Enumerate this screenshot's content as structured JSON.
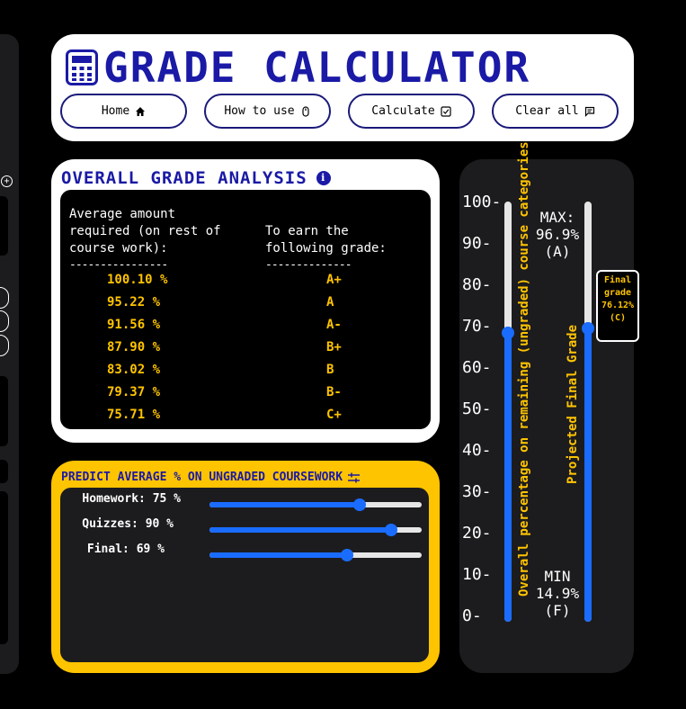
{
  "header": {
    "title": "GRADE CALCULATOR",
    "nav": [
      {
        "label": "Home",
        "icon": "home-icon"
      },
      {
        "label": "How to use",
        "icon": "mouse-icon"
      },
      {
        "label": "Calculate",
        "icon": "checkbox-icon"
      },
      {
        "label": "Clear all",
        "icon": "comment-icon"
      }
    ]
  },
  "analysis": {
    "title": "OVERALL GRADE ANALYSIS",
    "left_header": "Average amount required (on rest of course work):",
    "right_header": "To earn the following grade:",
    "left_divider": "----------------",
    "right_divider": "--------------",
    "rows": [
      {
        "required": "100.10 %",
        "grade": "A+"
      },
      {
        "required": "95.22 %",
        "grade": "A"
      },
      {
        "required": "91.56 %",
        "grade": "A-"
      },
      {
        "required": "87.90 %",
        "grade": "B+"
      },
      {
        "required": "83.02 %",
        "grade": "B"
      },
      {
        "required": "79.37 %",
        "grade": "B-"
      },
      {
        "required": "75.71 %",
        "grade": "C+"
      }
    ]
  },
  "predict": {
    "title": "PREDICT AVERAGE % ON UNGRADED COURSEWORK",
    "sliders": [
      {
        "label": "Homework: 75 %",
        "value": 75
      },
      {
        "label": "Quizzes: 90 %",
        "value": 90
      },
      {
        "label": "Final: 69 %",
        "value": 69
      }
    ]
  },
  "gauge": {
    "ticks": [
      "100-",
      "90-",
      "80-",
      "70-",
      "60-",
      "50-",
      "40-",
      "30-",
      "20-",
      "10-",
      "0-"
    ],
    "left_slider_label": "Overall percentage on remaining (ungraded) course categories",
    "left_slider_value": 75,
    "right_slider_label": "Projected Final Grade",
    "right_slider_value": 76.12,
    "max_label": "MAX:",
    "max_value": "96.9%",
    "max_grade": "(A)",
    "min_label": "MIN",
    "min_value": "14.9%",
    "min_grade": "(F)",
    "final_box": {
      "line1": "Final",
      "line2": "grade",
      "value": "76.12%",
      "grade": "(C)"
    }
  },
  "colors": {
    "accent_blue": "#1a1aa6",
    "slider_blue": "#1a6cff",
    "yellow": "#ffc400"
  }
}
